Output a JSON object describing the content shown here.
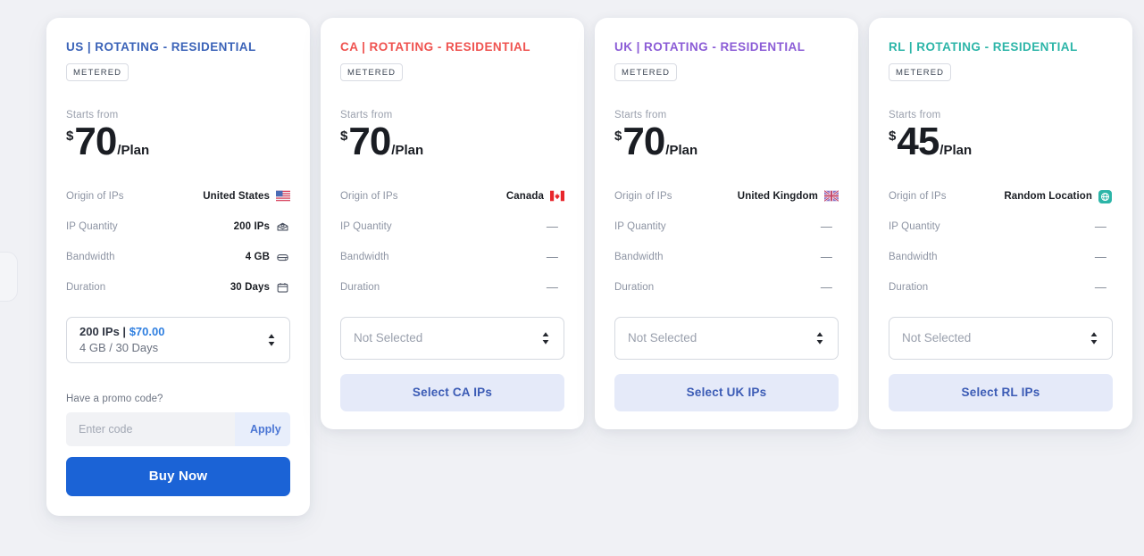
{
  "theme": {
    "page_background": "#f0f1f5",
    "card_background": "#ffffff",
    "buy_now_color": "#1b63d6",
    "select_button_background": "#e5eaf9",
    "select_button_text": "#3b5bb5"
  },
  "cards": [
    {
      "title": "US | ROTATING - RESIDENTIAL",
      "title_color": "#3b63b8",
      "badge": "METERED",
      "starts_from_label": "Starts from",
      "currency": "$",
      "price": "70",
      "period": "/Plan",
      "specs": [
        {
          "label": "Origin of IPs",
          "value": "United States",
          "icon": "flag-us-icon"
        },
        {
          "label": "IP Quantity",
          "value": "200 IPs",
          "icon": "server-stack-icon"
        },
        {
          "label": "Bandwidth",
          "value": "4 GB",
          "icon": "database-icon"
        },
        {
          "label": "Duration",
          "value": "30 Days",
          "icon": "calendar-icon"
        }
      ],
      "selected": true,
      "selection": {
        "line1_quantity": "200 IPs | ",
        "line1_price": "$70.00",
        "line2": "4 GB / 30 Days"
      },
      "promo_label": "Have a promo code?",
      "promo_placeholder": "Enter code",
      "promo_value": "",
      "apply_label": "Apply",
      "buy_label": "Buy Now"
    },
    {
      "title": "CA | ROTATING - RESIDENTIAL",
      "title_color": "#ef5350",
      "badge": "METERED",
      "starts_from_label": "Starts from",
      "currency": "$",
      "price": "70",
      "period": "/Plan",
      "specs": [
        {
          "label": "Origin of IPs",
          "value": "Canada",
          "icon": "flag-ca-icon"
        },
        {
          "label": "IP Quantity",
          "value": "—",
          "icon": "none"
        },
        {
          "label": "Bandwidth",
          "value": "—",
          "icon": "none"
        },
        {
          "label": "Duration",
          "value": "—",
          "icon": "none"
        }
      ],
      "selected": false,
      "select_placeholder": "Not Selected",
      "action_label": "Select CA IPs"
    },
    {
      "title": "UK | ROTATING - RESIDENTIAL",
      "title_color": "#8b5cd6",
      "badge": "METERED",
      "starts_from_label": "Starts from",
      "currency": "$",
      "price": "70",
      "period": "/Plan",
      "specs": [
        {
          "label": "Origin of IPs",
          "value": "United Kingdom",
          "icon": "flag-uk-icon"
        },
        {
          "label": "IP Quantity",
          "value": "—",
          "icon": "none"
        },
        {
          "label": "Bandwidth",
          "value": "—",
          "icon": "none"
        },
        {
          "label": "Duration",
          "value": "—",
          "icon": "none"
        }
      ],
      "selected": false,
      "select_placeholder": "Not Selected",
      "action_label": "Select UK IPs"
    },
    {
      "title": "RL | ROTATING - RESIDENTIAL",
      "title_color": "#2cb5a8",
      "badge": "METERED",
      "starts_from_label": "Starts from",
      "currency": "$",
      "price": "45",
      "period": "/Plan",
      "specs": [
        {
          "label": "Origin of IPs",
          "value": "Random Location",
          "icon": "globe-icon"
        },
        {
          "label": "IP Quantity",
          "value": "—",
          "icon": "none"
        },
        {
          "label": "Bandwidth",
          "value": "—",
          "icon": "none"
        },
        {
          "label": "Duration",
          "value": "—",
          "icon": "none"
        }
      ],
      "selected": false,
      "select_placeholder": "Not Selected",
      "action_label": "Select RL IPs"
    }
  ]
}
